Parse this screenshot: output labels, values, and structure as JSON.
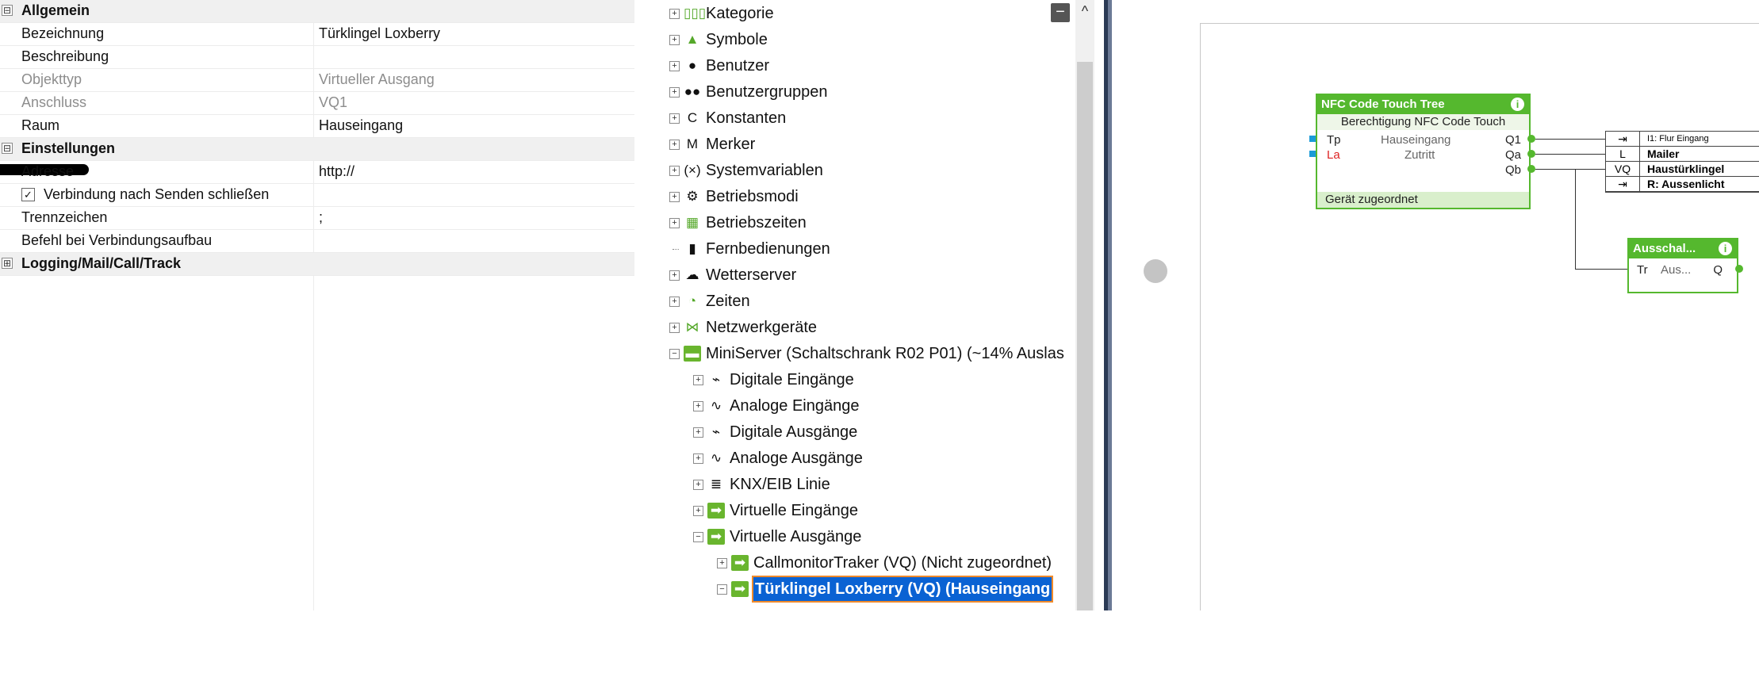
{
  "properties": {
    "rows": [
      {
        "type": "category",
        "expander": "⊟",
        "name": "Allgemein",
        "value": ""
      },
      {
        "type": "prop",
        "name": "Bezeichnung",
        "value": "Türklingel Loxberry"
      },
      {
        "type": "prop",
        "name": "Beschreibung",
        "value": ""
      },
      {
        "type": "disabled",
        "name": "Objekttyp",
        "value": "Virtueller Ausgang"
      },
      {
        "type": "disabled",
        "name": "Anschluss",
        "value": "VQ1"
      },
      {
        "type": "prop",
        "name": "Raum",
        "value": "Hauseingang"
      },
      {
        "type": "category",
        "expander": "⊟",
        "name": "Einstellungen",
        "value": ""
      },
      {
        "type": "prop",
        "name": "Adresse",
        "value": "http://"
      },
      {
        "type": "check",
        "name": "Verbindung nach Senden schließen",
        "value": "",
        "checked": "✓"
      },
      {
        "type": "prop",
        "name": "Trennzeichen",
        "value": ";"
      },
      {
        "type": "prop",
        "name": "Befehl bei Verbindungsaufbau",
        "value": ""
      },
      {
        "type": "category",
        "expander": "⊞",
        "name": "Logging/Mail/Call/Track",
        "value": ""
      }
    ]
  },
  "tree": {
    "items": [
      {
        "label": "Kategorie",
        "level": 0,
        "expander": "+",
        "icon": "▯▯▯",
        "icon_name": "category-icon"
      },
      {
        "label": "Symbole",
        "level": 0,
        "expander": "+",
        "icon": "▲",
        "icon_name": "image-icon"
      },
      {
        "label": "Benutzer",
        "level": 0,
        "expander": "+",
        "icon": "●",
        "icon_name": "user-icon"
      },
      {
        "label": "Benutzergruppen",
        "level": 0,
        "expander": "+",
        "icon": "●●",
        "icon_name": "users-icon"
      },
      {
        "label": "Konstanten",
        "level": 0,
        "expander": "+",
        "icon": "C",
        "icon_name": "constant-icon"
      },
      {
        "label": "Merker",
        "level": 0,
        "expander": "+",
        "icon": "M",
        "icon_name": "marker-icon"
      },
      {
        "label": "Systemvariablen",
        "level": 0,
        "expander": "+",
        "icon": "(×)",
        "icon_name": "variable-icon"
      },
      {
        "label": "Betriebsmodi",
        "level": 0,
        "expander": "+",
        "icon": "⚙",
        "icon_name": "gear-icon"
      },
      {
        "label": "Betriebszeiten",
        "level": 0,
        "expander": "+",
        "icon": "▦",
        "icon_name": "calendar-icon"
      },
      {
        "label": "Fernbedienungen",
        "level": 0,
        "expander": "",
        "icon": "▮",
        "icon_name": "remote-icon"
      },
      {
        "label": "Wetterserver",
        "level": 0,
        "expander": "+",
        "icon": "☁",
        "icon_name": "weather-icon"
      },
      {
        "label": "Zeiten",
        "level": 0,
        "expander": "+",
        "icon": "◔",
        "icon_name": "clock-icon"
      },
      {
        "label": "Netzwerkgeräte",
        "level": 0,
        "expander": "+",
        "icon": "⋈",
        "icon_name": "network-icon"
      },
      {
        "label": "MiniServer (Schaltschrank R02 P01) (~14% Auslas",
        "level": 0,
        "expander": "−",
        "icon": "▬",
        "icon_name": "miniserver-icon"
      },
      {
        "label": "Digitale Eingänge",
        "level": 1,
        "expander": "+",
        "icon": "⌁",
        "icon_name": "digital-input-icon"
      },
      {
        "label": "Analoge Eingänge",
        "level": 1,
        "expander": "+",
        "icon": "∿",
        "icon_name": "analog-input-icon"
      },
      {
        "label": "Digitale Ausgänge",
        "level": 1,
        "expander": "+",
        "icon": "⌁",
        "icon_name": "digital-output-icon"
      },
      {
        "label": "Analoge Ausgänge",
        "level": 1,
        "expander": "+",
        "icon": "∿",
        "icon_name": "analog-output-icon"
      },
      {
        "label": "KNX/EIB Linie",
        "level": 1,
        "expander": "+",
        "icon": "≣",
        "icon_name": "knx-icon"
      },
      {
        "label": "Virtuelle Eingänge",
        "level": 1,
        "expander": "+",
        "icon": "➡",
        "icon_name": "virtual-input-icon"
      },
      {
        "label": "Virtuelle Ausgänge",
        "level": 1,
        "expander": "−",
        "icon": "➡",
        "icon_name": "virtual-output-icon"
      },
      {
        "label": "CallmonitorTraker (VQ) (Nicht zugeordnet)",
        "level": 2,
        "expander": "+",
        "icon": "➡",
        "icon_name": "virtual-output-icon"
      },
      {
        "label": "Türklingel Loxberry (VQ) (Hauseingang",
        "level": 2,
        "expander": "−",
        "icon": "➡",
        "icon_name": "virtual-output-icon",
        "selected": true
      }
    ],
    "collapse_glyph": "−",
    "scroll_up_glyph": "^"
  },
  "canvas": {
    "nfc_block": {
      "title": "NFC Code Touch Tree",
      "info": "i",
      "subtitle": "Berechtigung NFC Code Touch",
      "in1": "Tp",
      "in1_desc": "Hauseingang",
      "out1": "Q1",
      "in2": "La",
      "in2_desc": "Zutritt",
      "out2": "Qa",
      "out3": "Qb",
      "footer": "Gerät zugeordnet"
    },
    "outputs": [
      {
        "code": "⇥",
        "label": "I1: Flur Eingang",
        "small": true
      },
      {
        "code": "L",
        "label": "Mailer",
        "small": false
      },
      {
        "code": "VQ",
        "label": "Haustürklingel",
        "small": false
      },
      {
        "code": "⇥",
        "label": "R: Aussenlicht",
        "small": false
      }
    ],
    "aus_block": {
      "title": "Ausschal...",
      "info": "i",
      "in1": "Tr",
      "in1_desc": "Aus...",
      "out1": "Q"
    }
  }
}
